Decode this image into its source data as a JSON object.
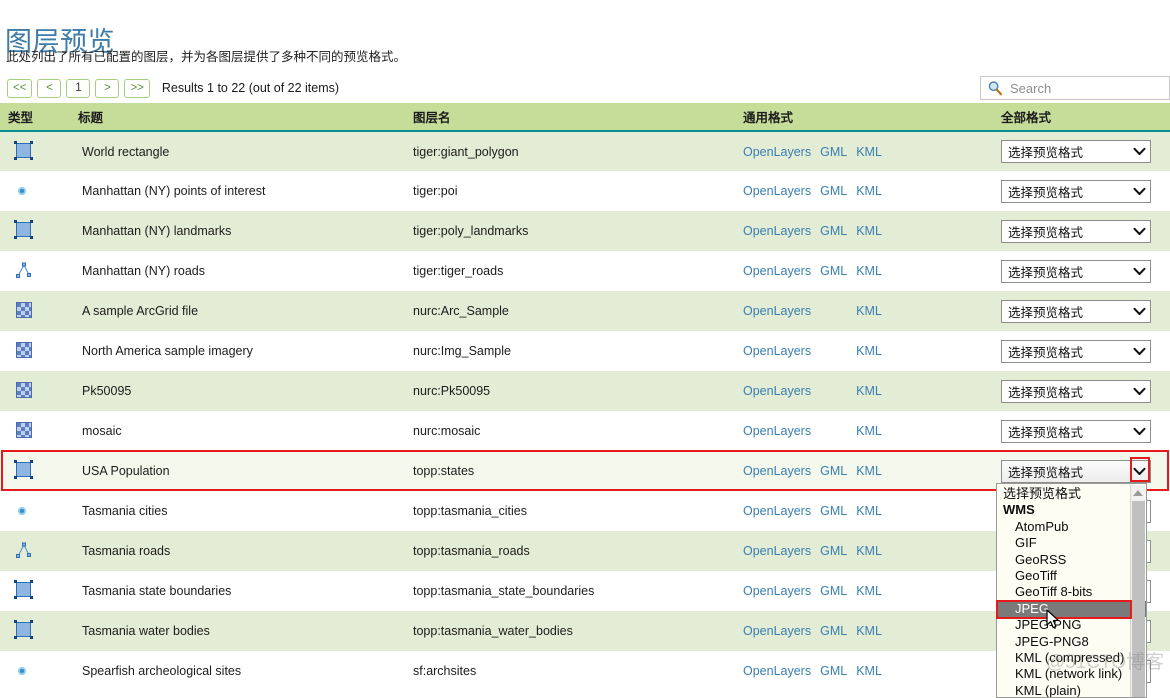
{
  "page": {
    "title": "图层预览",
    "description": "此处列出了所有已配置的图层，并为各图层提供了多种不同的预览格式。",
    "watermark": "@51CTO博客"
  },
  "pager": {
    "first_label": "<<",
    "prev_label": "<",
    "current_page": "1",
    "next_label": ">",
    "last_label": ">>",
    "results_text": "Results 1 to 22 (out of 22 items)"
  },
  "search": {
    "icon": "search-icon",
    "placeholder": "Search",
    "value": ""
  },
  "table": {
    "columns": [
      {
        "key": "type",
        "label": "类型"
      },
      {
        "key": "title",
        "label": "标题"
      },
      {
        "key": "name",
        "label": "图层名"
      },
      {
        "key": "common",
        "label": "通用格式"
      },
      {
        "key": "all",
        "label": "全部格式"
      }
    ],
    "select_placeholder": "选择预览格式",
    "rows": [
      {
        "icon": "polygon-icon",
        "title": "World rectangle",
        "name": "tiger:giant_polygon",
        "links": [
          "OpenLayers",
          "GML",
          "KML"
        ],
        "stripe": "odd",
        "highlighted": false
      },
      {
        "icon": "point-icon",
        "title": "Manhattan (NY) points of interest",
        "name": "tiger:poi",
        "links": [
          "OpenLayers",
          "GML",
          "KML"
        ],
        "stripe": "even",
        "highlighted": false
      },
      {
        "icon": "polygon-icon",
        "title": "Manhattan (NY) landmarks",
        "name": "tiger:poly_landmarks",
        "links": [
          "OpenLayers",
          "GML",
          "KML"
        ],
        "stripe": "odd",
        "highlighted": false
      },
      {
        "icon": "line-icon",
        "title": "Manhattan (NY) roads",
        "name": "tiger:tiger_roads",
        "links": [
          "OpenLayers",
          "GML",
          "KML"
        ],
        "stripe": "even",
        "highlighted": false
      },
      {
        "icon": "raster-icon",
        "title": "A sample ArcGrid file",
        "name": "nurc:Arc_Sample",
        "links": [
          "OpenLayers",
          "KML"
        ],
        "stripe": "odd",
        "highlighted": false
      },
      {
        "icon": "raster-icon",
        "title": "North America sample imagery",
        "name": "nurc:Img_Sample",
        "links": [
          "OpenLayers",
          "KML"
        ],
        "stripe": "even",
        "highlighted": false
      },
      {
        "icon": "raster-icon",
        "title": "Pk50095",
        "name": "nurc:Pk50095",
        "links": [
          "OpenLayers",
          "KML"
        ],
        "stripe": "odd",
        "highlighted": false
      },
      {
        "icon": "raster-icon",
        "title": "mosaic",
        "name": "nurc:mosaic",
        "links": [
          "OpenLayers",
          "KML"
        ],
        "stripe": "even",
        "highlighted": false
      },
      {
        "icon": "polygon-icon",
        "title": "USA Population",
        "name": "topp:states",
        "links": [
          "OpenLayers",
          "GML",
          "KML"
        ],
        "stripe": "odd",
        "highlighted": true
      },
      {
        "icon": "point-icon",
        "title": "Tasmania cities",
        "name": "topp:tasmania_cities",
        "links": [
          "OpenLayers",
          "GML",
          "KML"
        ],
        "stripe": "even",
        "highlighted": false
      },
      {
        "icon": "line-icon",
        "title": "Tasmania roads",
        "name": "topp:tasmania_roads",
        "links": [
          "OpenLayers",
          "GML",
          "KML"
        ],
        "stripe": "odd",
        "highlighted": false
      },
      {
        "icon": "polygon-icon",
        "title": "Tasmania state boundaries",
        "name": "topp:tasmania_state_boundaries",
        "links": [
          "OpenLayers",
          "GML",
          "KML"
        ],
        "stripe": "even",
        "highlighted": false
      },
      {
        "icon": "polygon-icon",
        "title": "Tasmania water bodies",
        "name": "topp:tasmania_water_bodies",
        "links": [
          "OpenLayers",
          "GML",
          "KML"
        ],
        "stripe": "odd",
        "highlighted": false
      },
      {
        "icon": "point-icon",
        "title": "Spearfish archeological sites",
        "name": "sf:archsites",
        "links": [
          "OpenLayers",
          "GML",
          "KML"
        ],
        "stripe": "even",
        "highlighted": false
      }
    ]
  },
  "dropdown": {
    "open": true,
    "owner_row": "USA Population",
    "selected_option": "JPEG",
    "options": [
      {
        "label": "选择预览格式",
        "kind": "placeholder"
      },
      {
        "label": "WMS",
        "kind": "group"
      },
      {
        "label": "AtomPub",
        "kind": "option"
      },
      {
        "label": "GIF",
        "kind": "option"
      },
      {
        "label": "GeoRSS",
        "kind": "option"
      },
      {
        "label": "GeoTiff",
        "kind": "option"
      },
      {
        "label": "GeoTiff 8-bits",
        "kind": "option"
      },
      {
        "label": "JPEG",
        "kind": "option"
      },
      {
        "label": "JPEG-PNG",
        "kind": "option"
      },
      {
        "label": "JPEG-PNG8",
        "kind": "option"
      },
      {
        "label": "KML (compressed)",
        "kind": "option"
      },
      {
        "label": "KML (network link)",
        "kind": "option"
      },
      {
        "label": "KML (plain)",
        "kind": "option"
      }
    ]
  },
  "colors": {
    "title": "#3e7ba6",
    "header_bg": "#c6dd9a",
    "header_rule": "#0a8e96",
    "row_odd": "#e3ecd4",
    "row_even": "#ffffff",
    "row_highlight": "#f4f8ec",
    "link": "#3a7fb2",
    "annotation": "#e51b1b",
    "dropdown_bg": "#fdfdf3",
    "dropdown_selected_bg": "#7a7a7a"
  }
}
